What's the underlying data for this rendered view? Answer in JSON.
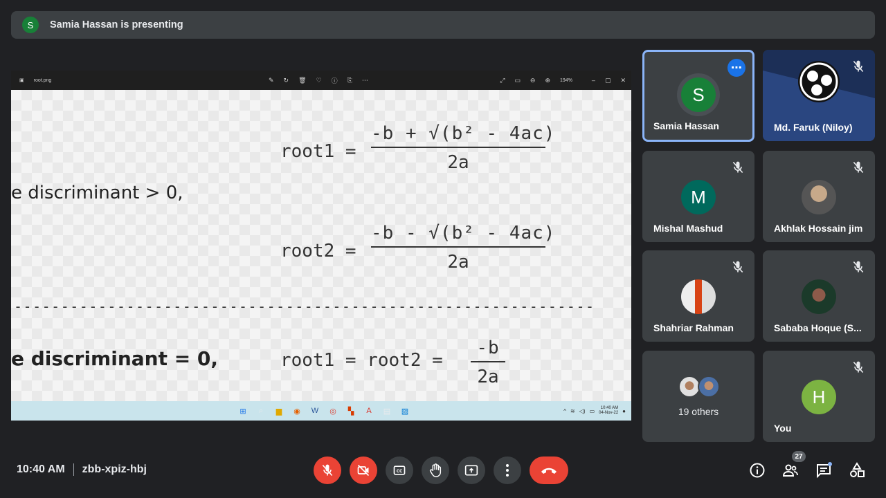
{
  "banner": {
    "initial": "S",
    "text": "Samia Hassan is presenting"
  },
  "viewer": {
    "file_name": "root.png",
    "zoom": "194%"
  },
  "slide": {
    "root1_label": "root1 =",
    "root1_num": "-b + √(b² - 4ac)",
    "denominator": "2a",
    "cond1": "e discriminant > 0,",
    "root2_label": "root2 =",
    "root2_num": "-b - √(b² - 4ac)",
    "cond2": "e discriminant = 0,",
    "root3_label": "root1 = root2 =",
    "root3_num": "-b",
    "dashes": "--------------------------------------------------------------"
  },
  "taskbar": {
    "time": "10:40 AM",
    "date": "04-Nov-22"
  },
  "tiles": [
    {
      "name": "Samia Hassan",
      "initial": "S",
      "color": "#188038"
    },
    {
      "name": "Md. Faruk (Niloy)"
    },
    {
      "name": "Mishal Mashud",
      "initial": "M",
      "color": "#00695c"
    },
    {
      "name": "Akhlak Hossain jim"
    },
    {
      "name": "Shahriar Rahman"
    },
    {
      "name": "Sababa Hoque (S..."
    },
    {
      "name": "19 others"
    },
    {
      "name": "You",
      "initial": "H",
      "color": "#7cb342"
    }
  ],
  "bottom": {
    "time": "10:40 AM",
    "meeting_code": "zbb-xpiz-hbj",
    "participants_count": "27"
  },
  "colors": {
    "accent": "#8ab4f8",
    "danger": "#ea4335",
    "tile": "#3c4043",
    "bg": "#202124"
  }
}
